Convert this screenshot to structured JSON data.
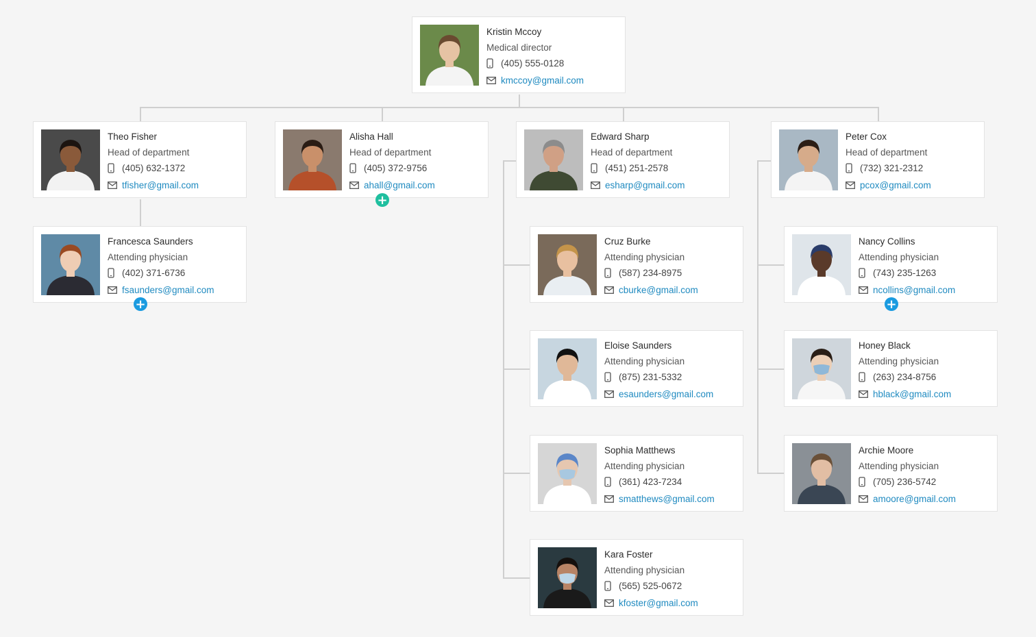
{
  "colors": {
    "background": "#f5f5f5",
    "card": "#ffffff",
    "connector": "#cfcfcf",
    "link": "#1f8ac0",
    "add_teal": "#1fbf9f",
    "add_blue": "#1b9be0"
  },
  "icons": {
    "phone": "phone-icon",
    "email": "mail-icon",
    "add": "plus-icon"
  },
  "people": [
    {
      "id": "kmccoy",
      "name": "Kristin Mccoy",
      "role": "Medical director",
      "phone": "(405) 555-0128",
      "email": "kmccoy@gmail.com"
    },
    {
      "id": "tfisher",
      "name": "Theo Fisher",
      "role": "Head of department",
      "phone": "(405) 632-1372",
      "email": "tfisher@gmail.com"
    },
    {
      "id": "ahall",
      "name": "Alisha Hall",
      "role": "Head of department",
      "phone": "(405) 372-9756",
      "email": "ahall@gmail.com"
    },
    {
      "id": "esharp",
      "name": "Edward Sharp",
      "role": "Head of department",
      "phone": "(451) 251-2578",
      "email": "esharp@gmail.com"
    },
    {
      "id": "pcox",
      "name": "Peter Cox",
      "role": "Head of department",
      "phone": "(732) 321-2312",
      "email": "pcox@gmail.com"
    },
    {
      "id": "fsaunders",
      "name": "Francesca Saunders",
      "role": "Attending physician",
      "phone": "(402) 371-6736",
      "email": "fsaunders@gmail.com"
    },
    {
      "id": "cburke",
      "name": "Cruz Burke",
      "role": "Attending physician",
      "phone": "(587) 234-8975",
      "email": "cburke@gmail.com"
    },
    {
      "id": "esaunders",
      "name": "Eloise Saunders",
      "role": "Attending physician",
      "phone": "(875) 231-5332",
      "email": "esaunders@gmail.com"
    },
    {
      "id": "smatthews",
      "name": "Sophia Matthews",
      "role": "Attending physician",
      "phone": "(361) 423-7234",
      "email": "smatthews@gmail.com"
    },
    {
      "id": "kfoster",
      "name": "Kara Foster",
      "role": "Attending physician",
      "phone": "(565) 525-0672",
      "email": "kfoster@gmail.com"
    },
    {
      "id": "ncollins",
      "name": "Nancy Collins",
      "role": "Attending physician",
      "phone": "(743) 235-1263",
      "email": "ncollins@gmail.com"
    },
    {
      "id": "hblack",
      "name": "Honey Black",
      "role": "Attending physician",
      "phone": "(263) 234-8756",
      "email": "hblack@gmail.com"
    },
    {
      "id": "amoore",
      "name": "Archie Moore",
      "role": "Attending physician",
      "phone": "(705) 236-5742",
      "email": "amoore@gmail.com"
    }
  ]
}
